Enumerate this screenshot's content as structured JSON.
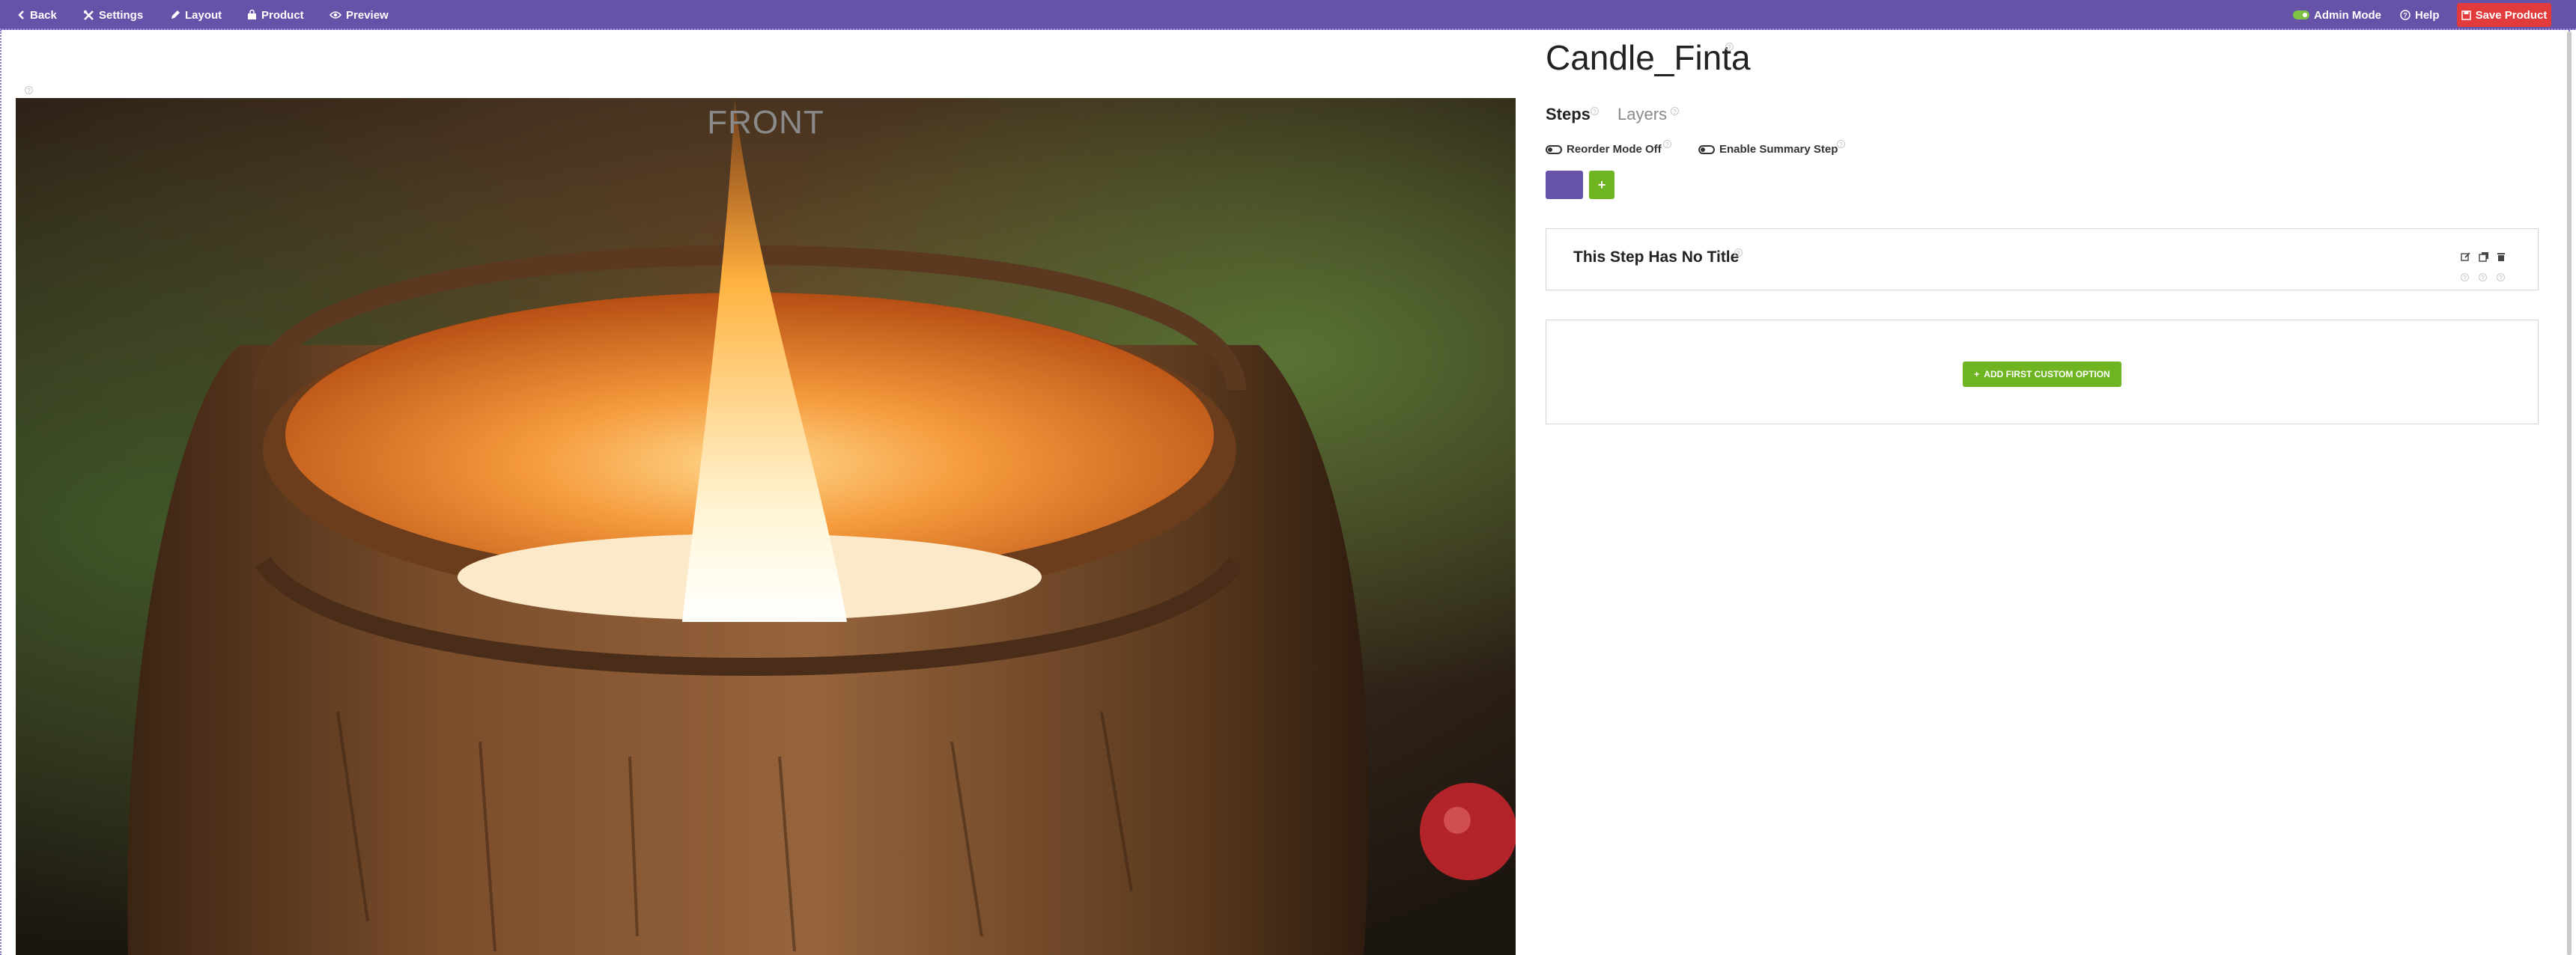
{
  "topbar": {
    "back_label": "Back",
    "settings_label": "Settings",
    "layout_label": "Layout",
    "product_label": "Product",
    "preview_label": "Preview",
    "admin_mode_label": "Admin Mode",
    "help_label": "Help",
    "save_label": "Save Product",
    "admin_mode_on": true
  },
  "canvas": {
    "view_label": "FRONT"
  },
  "product": {
    "title": "Candle_Finta"
  },
  "tabs": [
    {
      "label": "Steps",
      "active": true
    },
    {
      "label": "Layers",
      "active": false
    }
  ],
  "options": {
    "reorder_label": "Reorder Mode Off",
    "summary_label": "Enable Summary Step",
    "add_symbol": "+"
  },
  "step": {
    "title": "This Step Has No Title"
  },
  "custom_options": {
    "add_first_label": "ADD FIRST CUSTOM OPTION",
    "add_symbol": "+"
  },
  "colors": {
    "topbar": "#6652a8",
    "save": "#e23b3b",
    "accent_green": "#6fb522",
    "step_swatch": "#6652a8"
  },
  "help_glyph": "?"
}
